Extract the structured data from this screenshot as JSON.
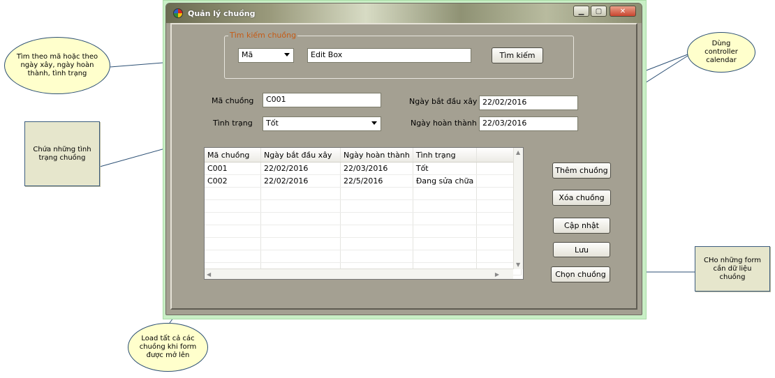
{
  "window": {
    "title": "Quản lý chuồng"
  },
  "search_group": {
    "legend": "Tìm kiếm chuồng",
    "field_select": "Mã",
    "text_value": "Edit Box",
    "search_button": "Tìm kiếm"
  },
  "form": {
    "ma_chuong_label": "Mã chuồng",
    "ma_chuong_value": "C001",
    "tinh_trang_label": "Tình trạng",
    "tinh_trang_value": "Tốt",
    "ngay_bat_dau_label": "Ngày bắt đầu xây",
    "ngay_bat_dau_value": "22/02/2016",
    "ngay_hoan_thanh_label": "Ngày hoàn thành",
    "ngay_hoan_thanh_value": "22/03/2016"
  },
  "grid": {
    "columns": [
      "Mã chuồng",
      "Ngày bắt đầu xây",
      "Ngày hoàn thành",
      "Tình trạng"
    ],
    "rows": [
      [
        "C001",
        "22/02/2016",
        "22/03/2016",
        "Tốt"
      ],
      [
        "C002",
        "22/02/2016",
        "22/5/2016",
        "Đang sửa chữa"
      ]
    ]
  },
  "buttons": {
    "them": "Thêm chuồng",
    "xoa": "Xóa chuồng",
    "cap_nhat": "Cập nhật",
    "luu": "Lưu",
    "chon": "Chọn chuồng"
  },
  "annotations": {
    "search_note": "Tìm theo mã hoặc theo ngày xây, ngày hoàn thành, tình trạng",
    "calendar_note": "Dùng controller calendar",
    "status_note": "Chứa những tình trạng chuồng",
    "load_note": "Load tất cả các chuồng khi form được mở lên",
    "form_note": "CHo những form cần dữ liệu chuồng"
  }
}
